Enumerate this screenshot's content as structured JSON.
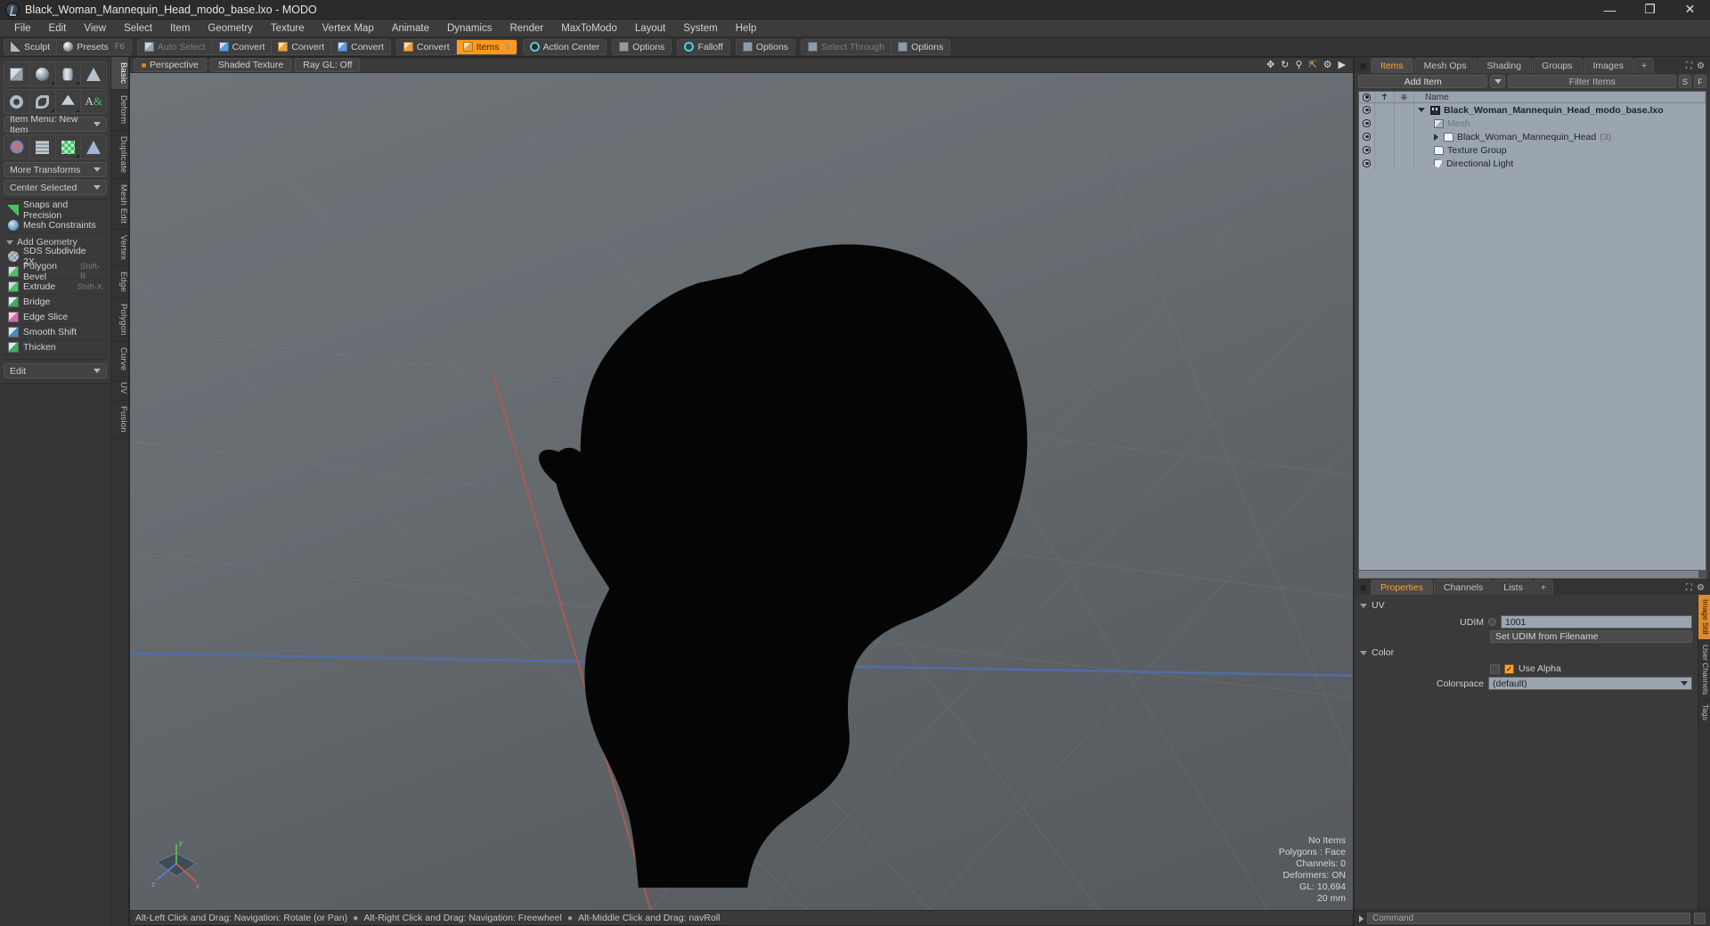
{
  "window": {
    "title": "Black_Woman_Mannequin_Head_modo_base.lxo - MODO",
    "minimize": "—",
    "maximize": "❐",
    "close": "✕"
  },
  "menubar": [
    "File",
    "Edit",
    "View",
    "Select",
    "Item",
    "Geometry",
    "Texture",
    "Vertex Map",
    "Animate",
    "Dynamics",
    "Render",
    "MaxToModo",
    "Layout",
    "System",
    "Help"
  ],
  "modebar": {
    "group1": [
      {
        "label": "Sculpt",
        "shortcut": "",
        "icon": "pen-icon",
        "state": "normal"
      },
      {
        "label": "Presets",
        "shortcut": "F6",
        "icon": "sphere-icon",
        "state": "normal"
      }
    ],
    "group2": [
      {
        "label": "Auto Select",
        "shortcut": "",
        "icon": "cube-icon",
        "state": "dim"
      },
      {
        "label": "Convert",
        "shortcut": "",
        "icon": "cube-blue-icon",
        "state": "normal"
      },
      {
        "label": "Convert",
        "shortcut": "",
        "icon": "cube-orange-icon",
        "state": "normal"
      },
      {
        "label": "Convert",
        "shortcut": "",
        "icon": "cube-blue-icon",
        "state": "normal"
      }
    ],
    "group3": [
      {
        "label": "Convert",
        "shortcut": "",
        "icon": "cube-orange-icon",
        "state": "normal"
      },
      {
        "label": "Items",
        "shortcut": "5",
        "icon": "cube-orange-icon",
        "state": "active"
      }
    ],
    "group4": [
      {
        "label": "Action Center",
        "shortcut": "",
        "icon": "target-icon",
        "state": "normal"
      }
    ],
    "group5": [
      {
        "label": "Options",
        "shortcut": "",
        "icon": "square-icon",
        "state": "normal"
      }
    ],
    "group6": [
      {
        "label": "Falloff",
        "shortcut": "",
        "icon": "ring-icon",
        "state": "normal"
      }
    ],
    "group7": [
      {
        "label": "Options",
        "shortcut": "",
        "icon": "square-icon",
        "state": "normal"
      }
    ],
    "group8": [
      {
        "label": "Select Through",
        "shortcut": "",
        "icon": "square-icon",
        "state": "dim"
      },
      {
        "label": "Options",
        "shortcut": "",
        "icon": "square-icon",
        "state": "normal"
      }
    ]
  },
  "leftpanel": {
    "primitives_row1": [
      "cube-primitive",
      "sphere-primitive",
      "cylinder-primitive",
      "cone-primitive"
    ],
    "primitives_row2": [
      "torus-primitive",
      "spiral-primitive",
      "polygon-primitive",
      "text-primitive"
    ],
    "item_menu": "Item Menu: New Item",
    "transform_row": [
      "transform-gizmo",
      "grid-deform",
      "checker-deform",
      "lattice-deform"
    ],
    "more_transforms": "More Transforms",
    "center_selected": "Center Selected",
    "snaps": {
      "label": "Snaps and Precision",
      "icon": "snap-icon"
    },
    "constraints": {
      "label": "Mesh Constraints",
      "icon": "mesh-constraints-icon"
    },
    "add_geometry_header": "Add Geometry",
    "geometry_items": [
      {
        "label": "SDS Subdivide 2X",
        "shortcut": "",
        "icon": "sds-icon"
      },
      {
        "label": "Polygon Bevel",
        "shortcut": "Shift-B",
        "icon": "bevel-icon"
      },
      {
        "label": "Extrude",
        "shortcut": "Shift-X",
        "icon": "extrude-icon"
      },
      {
        "label": "Bridge",
        "shortcut": "",
        "icon": "bridge-icon"
      },
      {
        "label": "Edge Slice",
        "shortcut": "",
        "icon": "edge-slice-icon"
      },
      {
        "label": "Smooth Shift",
        "shortcut": "",
        "icon": "smooth-shift-icon"
      },
      {
        "label": "Thicken",
        "shortcut": "",
        "icon": "thicken-icon"
      }
    ],
    "edit_dropdown": "Edit"
  },
  "vstrip": [
    {
      "label": "Basic",
      "selected": true
    },
    {
      "label": "Deform",
      "selected": false
    },
    {
      "label": "Duplicate",
      "selected": false
    },
    {
      "label": "Mesh Edit",
      "selected": false
    },
    {
      "label": "Vertex",
      "selected": false
    },
    {
      "label": "Edge",
      "selected": false
    },
    {
      "label": "Polygon",
      "selected": false
    },
    {
      "label": "Curve",
      "selected": false
    },
    {
      "label": "UV",
      "selected": false
    },
    {
      "label": "Fusion",
      "selected": false
    }
  ],
  "viewport": {
    "perspective": "Perspective",
    "shading": "Shaded Texture",
    "raygl": "Ray GL: Off",
    "icons": [
      "move-icon",
      "rotate-icon",
      "zoom-icon",
      "fit-icon",
      "gear-icon",
      "play-icon"
    ],
    "stats": [
      "No Items",
      "Polygons : Face",
      "Channels: 0",
      "Deformers: ON",
      "GL: 10,694",
      "20 mm"
    ],
    "axis_labels": {
      "x": "x",
      "y": "y",
      "z": "z"
    }
  },
  "statusbar": {
    "hints": [
      "Alt-Left Click and Drag: Navigation: Rotate (or Pan)",
      "Alt-Right Click and Drag: Navigation: Freewheel",
      "Alt-Middle Click and Drag: navRoll"
    ],
    "separator": "●"
  },
  "rightpanel": {
    "tabs": [
      {
        "label": "Items",
        "selected": true
      },
      {
        "label": "Mesh Ops",
        "selected": false
      },
      {
        "label": "Shading",
        "selected": false
      },
      {
        "label": "Groups",
        "selected": false
      },
      {
        "label": "Images",
        "selected": false
      },
      {
        "label": "+",
        "selected": false
      }
    ],
    "add_item": "Add Item",
    "filter_items": "Filter Items",
    "btn_s": "S",
    "btn_f": "F",
    "tree_headers": {
      "visibility": "eye-icon",
      "lock": "lock-icon",
      "transform": "axis-icon",
      "name": "Name"
    },
    "tree_rows": [
      {
        "name": "Black_Woman_Mannequin_Head_modo_base.lxo",
        "depth": 0,
        "bold": true,
        "icon": "scene-icon",
        "expander": "down",
        "count": "",
        "dim": false
      },
      {
        "name": "Mesh",
        "depth": 1,
        "bold": false,
        "icon": "mesh-icon",
        "expander": "none",
        "count": "",
        "dim": true
      },
      {
        "name": "Black_Woman_Mannequin_Head",
        "depth": 1,
        "bold": false,
        "icon": "folder-icon",
        "expander": "right",
        "count": "(3)",
        "dim": false
      },
      {
        "name": "Texture Group",
        "depth": 1,
        "bold": false,
        "icon": "folder-icon",
        "expander": "none",
        "count": "",
        "dim": false
      },
      {
        "name": "Directional Light",
        "depth": 1,
        "bold": false,
        "icon": "light-icon",
        "expander": "none",
        "count": "",
        "dim": false
      }
    ]
  },
  "properties": {
    "tabs": [
      {
        "label": "Properties",
        "selected": true
      },
      {
        "label": "Channels",
        "selected": false
      },
      {
        "label": "Lists",
        "selected": false
      },
      {
        "label": "+",
        "selected": false
      }
    ],
    "section_uv": "UV",
    "udim_label": "UDIM",
    "udim_value": "1001",
    "set_udim": "Set UDIM from Filename",
    "section_color": "Color",
    "use_alpha_label": "Use Alpha",
    "use_alpha_checked": true,
    "colorspace_label": "Colorspace",
    "colorspace_value": "(default)",
    "side_tabs": [
      {
        "label": "Image Still",
        "highlight": true
      },
      {
        "label": "User Channels",
        "highlight": false
      },
      {
        "label": "Tags",
        "highlight": false
      }
    ]
  },
  "command": {
    "placeholder": "Command"
  },
  "colors": {
    "accent": "#ffa22b",
    "panel": "#3a3a3a",
    "tree": "#9aa5b0",
    "titlebar": "#2b2b2b"
  }
}
